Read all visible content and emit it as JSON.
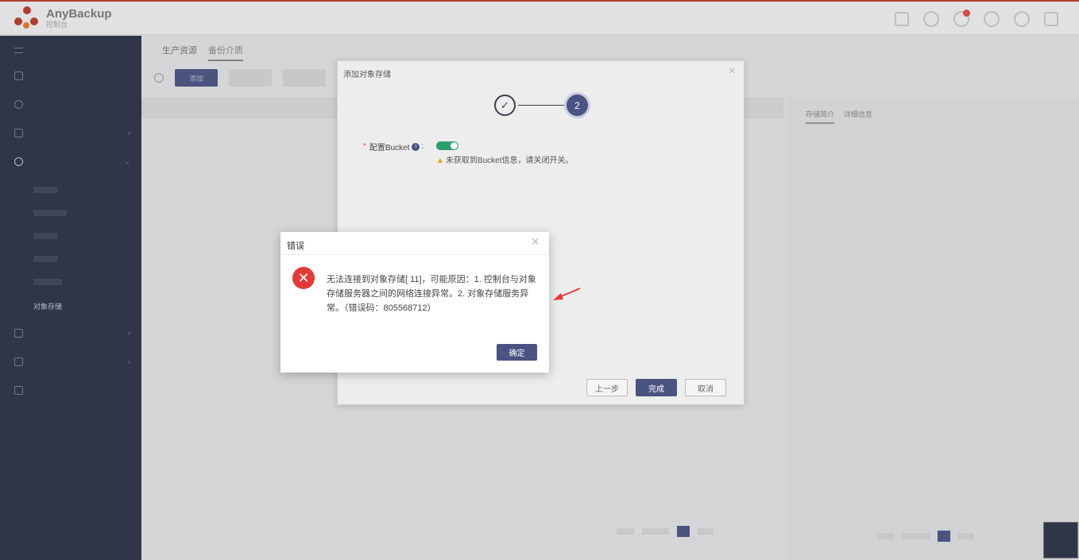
{
  "app": {
    "name": "AnyBackup",
    "subtitle": "控制台"
  },
  "main_tabs": [
    "生产资源",
    "备份介质"
  ],
  "toolbar": {
    "add_label": "添加"
  },
  "right_panel": {
    "tabs": [
      "存储简介",
      "详细信息"
    ]
  },
  "sidebar": {
    "active_sub": "对象存储"
  },
  "wizard": {
    "title": "添加对象存储",
    "step_current": "2",
    "bucket_label": "配置Bucket",
    "warning": "未获取到Bucket信息，请关闭开关。",
    "prev_button": "上一步",
    "finish_button": "完成",
    "cancel_button": "取消"
  },
  "error_dialog": {
    "title": "错误",
    "message": "无法连接到对象存储[              11]，可能原因：1. 控制台与对象存储服务器之间的网络连接异常。2. 对象存储服务异常。（错误码：805568712）",
    "ok_button": "确定"
  },
  "colors": {
    "accent": "#4b5382",
    "sidebar": "#2b3245",
    "error": "#e53935",
    "toggle_on": "#2e9e6e",
    "annotation_arrow": "#e53935"
  }
}
